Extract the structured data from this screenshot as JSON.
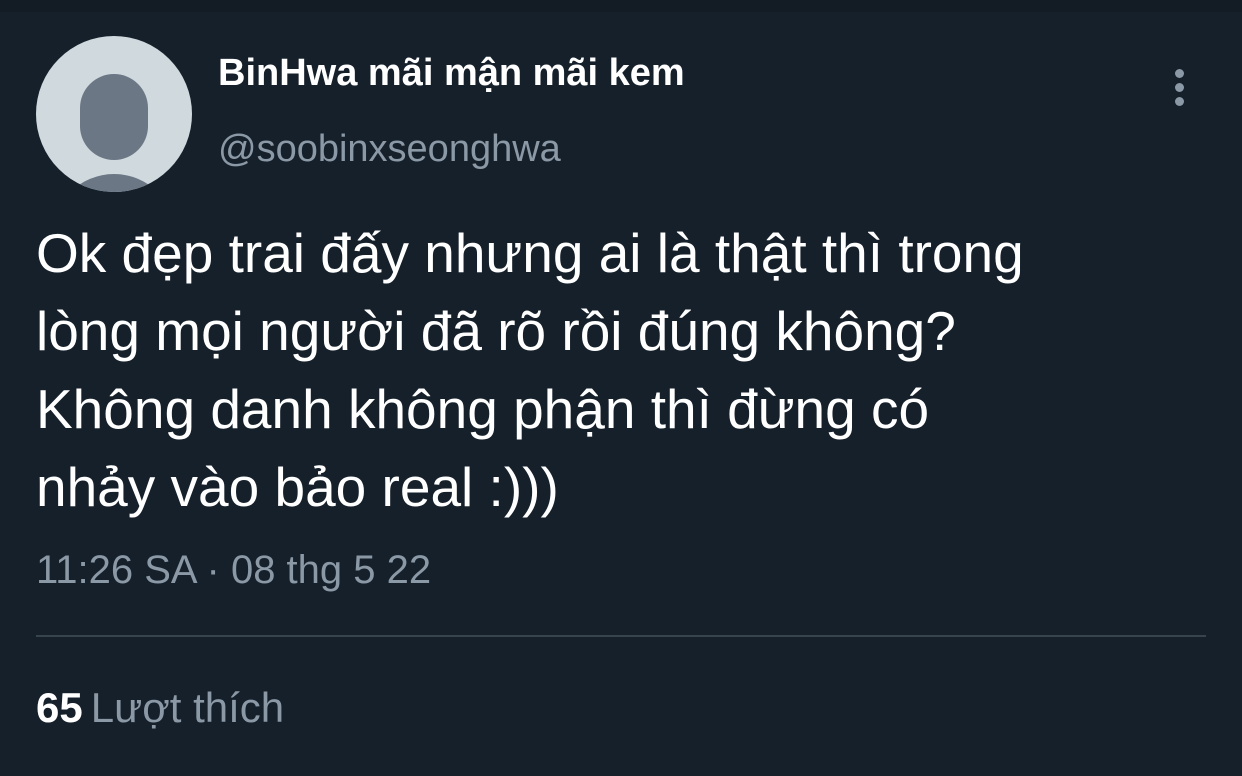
{
  "tweet": {
    "author": {
      "display_name": "BinHwa mãi mận mãi kem",
      "handle": "@soobinxseonghwa",
      "avatar_icon": "default-avatar-icon"
    },
    "more_icon": "more-options-icon",
    "text_lines": [
      "Ok đẹp trai đấy nhưng ai là thật thì trong",
      "lòng mọi người đã rõ rồi đúng không?",
      "Không danh không phận thì đừng có",
      "nhảy vào bảo real :)))"
    ],
    "timestamp": "11:26 SA · 08 thg 5 22",
    "stats": {
      "likes_count": "65",
      "likes_label": "Lượt thích"
    }
  },
  "colors": {
    "background": "#15202b",
    "primary_text": "#ffffff",
    "secondary_text": "#8b98a5",
    "divider": "#38444d",
    "avatar_bg": "#cfd9de",
    "avatar_fg": "#6b7785"
  }
}
